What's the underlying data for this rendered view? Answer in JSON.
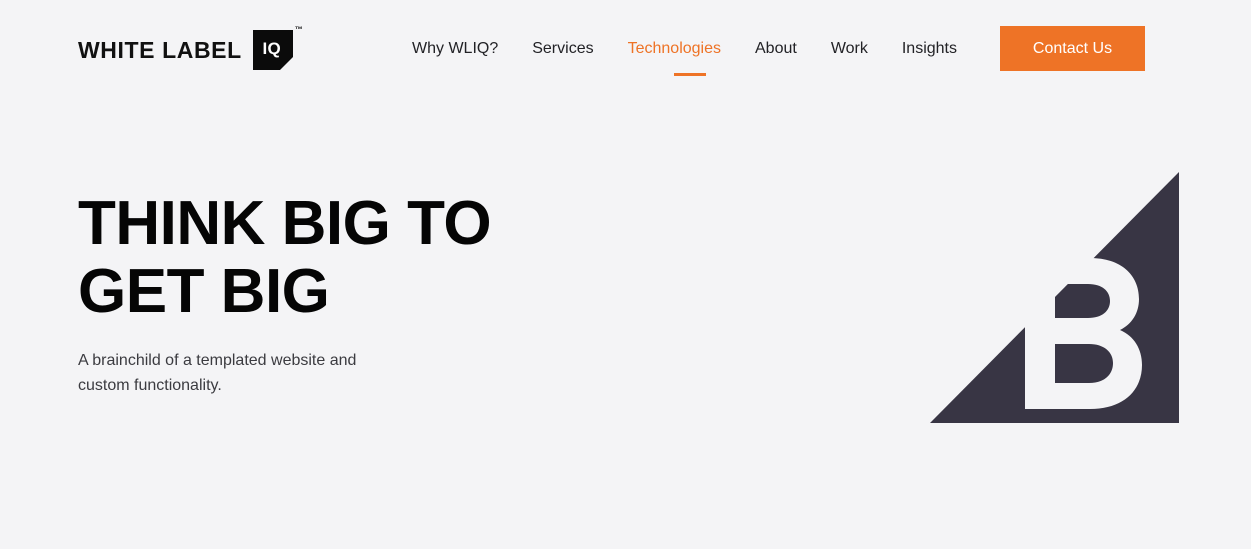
{
  "page": {
    "background_color": "#f4f4f6",
    "accent_color": "#ee7326",
    "dark_color": "#383544"
  },
  "header": {
    "logo": {
      "wordmark": "WHITE LABEL",
      "badge_text": "IQ",
      "trademark": "™"
    },
    "nav": [
      {
        "label": "Why WLIQ?",
        "active": false
      },
      {
        "label": "Services",
        "active": false
      },
      {
        "label": "Technologies",
        "active": true
      },
      {
        "label": "About",
        "active": false
      },
      {
        "label": "Work",
        "active": false
      },
      {
        "label": "Insights",
        "active": false
      }
    ],
    "cta": {
      "label": "Contact Us"
    }
  },
  "hero": {
    "title": "Think Big To\nGet Big",
    "subtitle": "A brainchild of a templated website and\ncustom functionality.",
    "mark_letter": "B"
  }
}
